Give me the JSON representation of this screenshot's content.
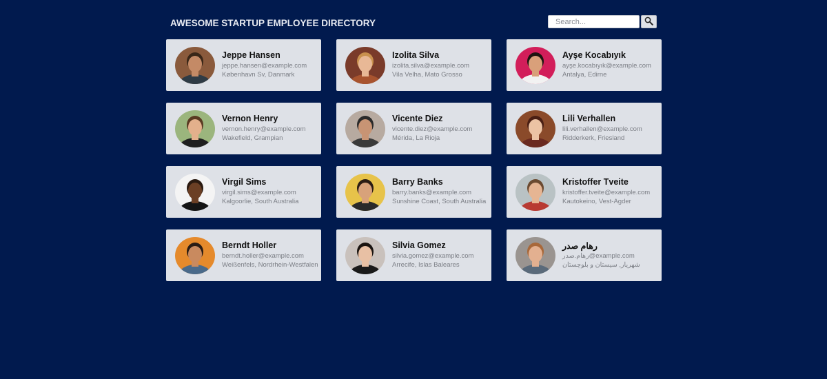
{
  "header": {
    "title": "AWESOME STARTUP EMPLOYEE DIRECTORY",
    "search_placeholder": "Search...",
    "search_icon": "magnifier-icon"
  },
  "employees": [
    {
      "name": "Jeppe Hansen",
      "email": "jeppe.hansen@example.com",
      "location": "København Sv, Danmark",
      "avatar_bg": "#8a5a3c",
      "skin": "#c48a66",
      "hair": "#3a2718",
      "shirt": "#2f3b45"
    },
    {
      "name": "Izolita Silva",
      "email": "izolita.silva@example.com",
      "location": "Vila Velha, Mato Grosso",
      "avatar_bg": "#7a3b2a",
      "skin": "#e8b896",
      "hair": "#c9914e",
      "shirt": "#a8542f"
    },
    {
      "name": "Ayşe Kocabıyık",
      "email": "ayşe.kocabıyık@example.com",
      "location": "Antalya, Edirne",
      "avatar_bg": "#d21e5a",
      "skin": "#d9a07a",
      "hair": "#1e1410",
      "shirt": "#f2f2f2"
    },
    {
      "name": "Vernon Henry",
      "email": "vernon.henry@example.com",
      "location": "Wakefield, Grampian",
      "avatar_bg": "#9bb57d",
      "skin": "#e3b08c",
      "hair": "#5a3a22",
      "shirt": "#1f1f1f"
    },
    {
      "name": "Vicente Diez",
      "email": "vicente.diez@example.com",
      "location": "Mérida, La Rioja",
      "avatar_bg": "#b7aaa0",
      "skin": "#c89474",
      "hair": "#2a2a2a",
      "shirt": "#3a3a3a"
    },
    {
      "name": "Lili Verhallen",
      "email": "lili.verhallen@example.com",
      "location": "Ridderkerk, Friesland",
      "avatar_bg": "#8a4a2a",
      "skin": "#ecc3a4",
      "hair": "#4a1f14",
      "shirt": "#6a2a20"
    },
    {
      "name": "Virgil Sims",
      "email": "virgil.sims@example.com",
      "location": "Kalgoorlie, South Australia",
      "avatar_bg": "#f4f4f4",
      "skin": "#6b3f24",
      "hair": "#2a1a10",
      "shirt": "#151515"
    },
    {
      "name": "Barry Banks",
      "email": "barry.banks@example.com",
      "location": "Sunshine Coast, South Australia",
      "avatar_bg": "#e7c34a",
      "skin": "#d8a27a",
      "hair": "#2a1c14",
      "shirt": "#2a2a2a"
    },
    {
      "name": "Kristoffer Tveite",
      "email": "kristoffer.tveite@example.com",
      "location": "Kautokeino, Vest-Agder",
      "avatar_bg": "#b9c2c4",
      "skin": "#e6b593",
      "hair": "#6b4a30",
      "shirt": "#b83a32"
    },
    {
      "name": "Berndt Holler",
      "email": "berndt.holler@example.com",
      "location": "Weißenfels, Nordrhein-Westfalen",
      "avatar_bg": "#e58a2c",
      "skin": "#c98a5f",
      "hair": "#2a1c14",
      "shirt": "#4a6a8a"
    },
    {
      "name": "Silvia Gomez",
      "email": "silvia.gomez@example.com",
      "location": "Arrecife, Islas Baleares",
      "avatar_bg": "#c9c1bc",
      "skin": "#e8c0a4",
      "hair": "#1a1410",
      "shirt": "#1a1a1a"
    },
    {
      "name": "رهام صدر",
      "email": "رهام.صدر@example.com",
      "location": "شهریار, سیستان و بلوچستان",
      "avatar_bg": "#9a9490",
      "skin": "#e3b090",
      "hair": "#a8683a",
      "shirt": "#5a6a7a"
    }
  ]
}
